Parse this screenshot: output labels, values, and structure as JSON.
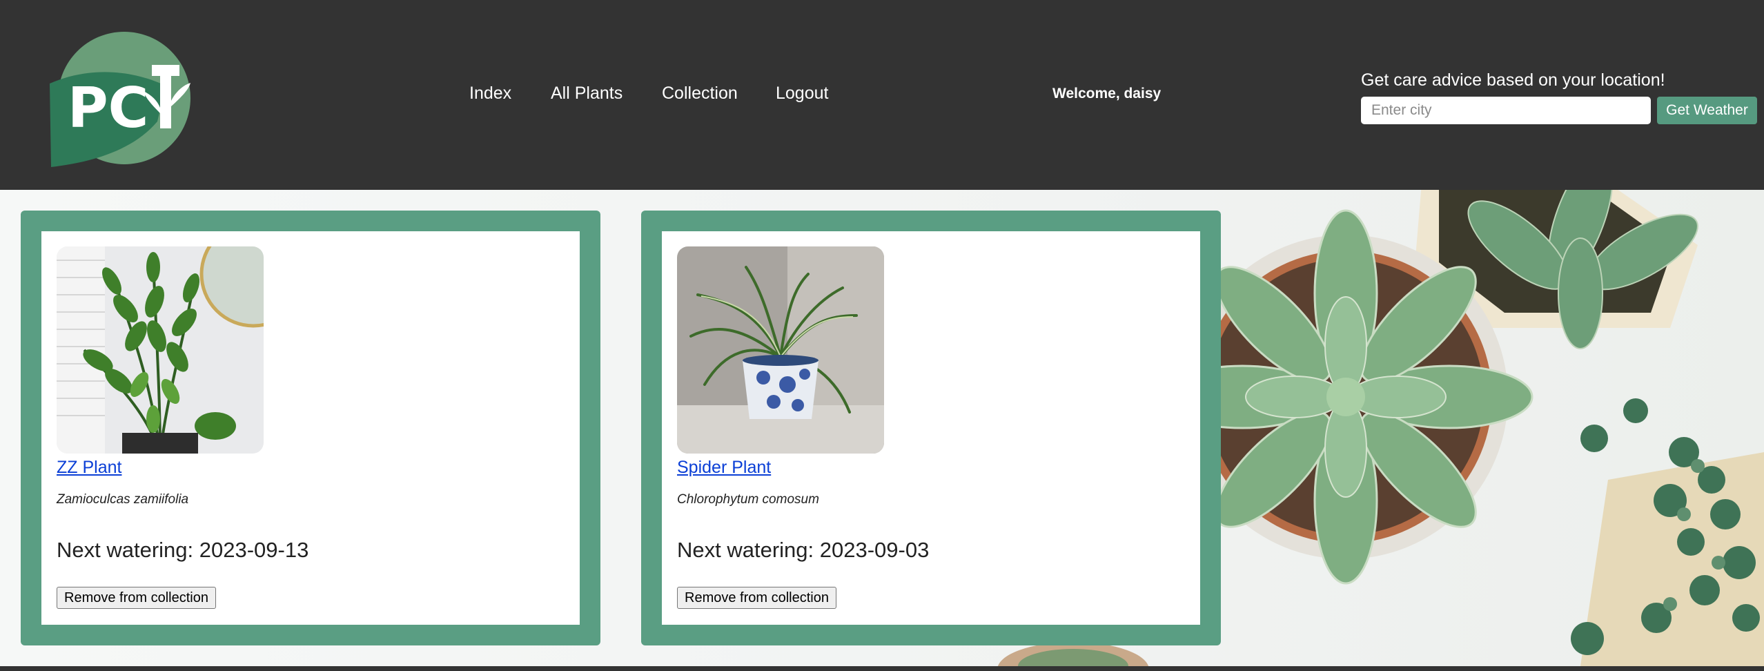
{
  "header": {
    "logo_text": "PCT",
    "nav": [
      {
        "label": "Index"
      },
      {
        "label": "All Plants"
      },
      {
        "label": "Collection"
      },
      {
        "label": "Logout"
      }
    ],
    "welcome": "Welcome, daisy",
    "weather": {
      "prompt": "Get care advice based on your location!",
      "input_placeholder": "Enter city",
      "input_value": "",
      "button_label": "Get Weather"
    }
  },
  "collection": [
    {
      "name": "ZZ Plant",
      "scientific_name": "Zamioculcas zamiifolia",
      "next_watering": "Next watering: 2023-09-13",
      "remove_label": "Remove from collection"
    },
    {
      "name": "Spider Plant",
      "scientific_name": "Chlorophytum comosum",
      "next_watering": "Next watering: 2023-09-03",
      "remove_label": "Remove from collection"
    }
  ],
  "colors": {
    "header_bg": "#333333",
    "accent_green": "#5a9e83",
    "button_green": "#569a80",
    "link_blue": "#0b3fd6"
  },
  "icons": {
    "logo": "pct-leaf-logo-icon"
  }
}
